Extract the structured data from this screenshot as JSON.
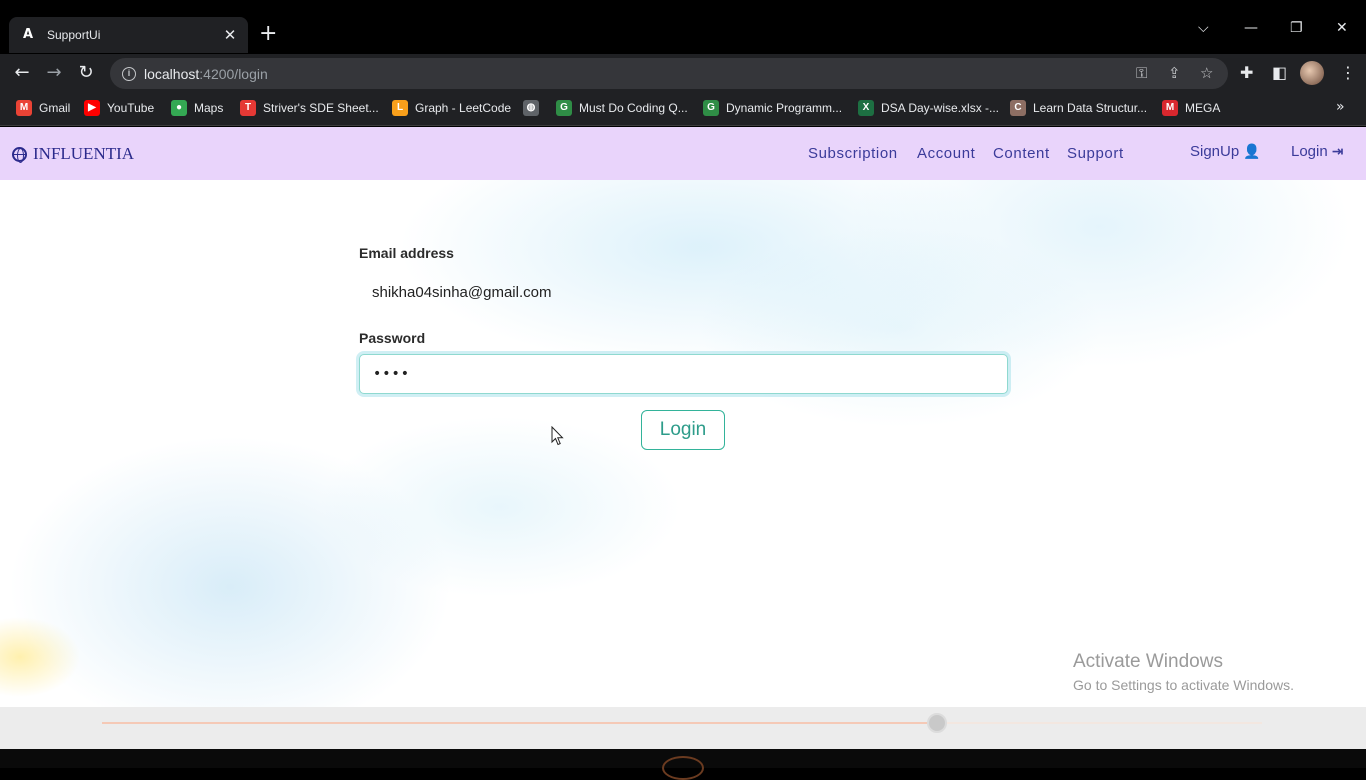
{
  "browser": {
    "tab_title": "SupportUi",
    "tab_favicon": "A",
    "url_host": "localhost",
    "url_path": ":4200/login",
    "bookmarks": [
      {
        "label": "Gmail",
        "icon": "gmail-icon",
        "color": "#ea4335",
        "glyph": "M"
      },
      {
        "label": "YouTube",
        "icon": "youtube-icon",
        "color": "#ff0000",
        "glyph": "▶"
      },
      {
        "label": "Maps",
        "icon": "maps-icon",
        "color": "#34a853",
        "glyph": "●"
      },
      {
        "label": "Striver's SDE Sheet...",
        "icon": "tuf-icon",
        "color": "#e53935",
        "glyph": "T"
      },
      {
        "label": "Graph - LeetCode",
        "icon": "leetcode-icon",
        "color": "#f89f1b",
        "glyph": "L"
      },
      {
        "label": "",
        "icon": "globe-icon",
        "color": "#5f6368",
        "glyph": "◍"
      },
      {
        "label": "Must Do Coding Q...",
        "icon": "gfg-icon",
        "color": "#2f8d46",
        "glyph": "G"
      },
      {
        "label": "Dynamic Programm...",
        "icon": "gfg-icon",
        "color": "#2f8d46",
        "glyph": "G"
      },
      {
        "label": "DSA Day-wise.xlsx -...",
        "icon": "excel-icon",
        "color": "#1d6f42",
        "glyph": "X"
      },
      {
        "label": "Learn Data Structur...",
        "icon": "codechef-icon",
        "color": "#8d6e63",
        "glyph": "C"
      },
      {
        "label": "MEGA",
        "icon": "mega-icon",
        "color": "#d9272e",
        "glyph": "M"
      }
    ]
  },
  "navbar": {
    "brand": "INFLUENTIA",
    "links": [
      "Subscription",
      "Account",
      "Content",
      "Support"
    ],
    "signup": "SignUp",
    "login": "Login",
    "bg_color": "#e9d4fb",
    "text_color": "#3b3b9a"
  },
  "form": {
    "email_label": "Email address",
    "email_value": "shikha04sinha@gmail.com",
    "password_label": "Password",
    "password_value": "••••",
    "submit_label": "Login",
    "accent_color": "#33b39a"
  },
  "watermark": {
    "line1": "Activate Windows",
    "line2": "Go to Settings to activate Windows."
  },
  "media": {
    "progress": 0.72
  }
}
